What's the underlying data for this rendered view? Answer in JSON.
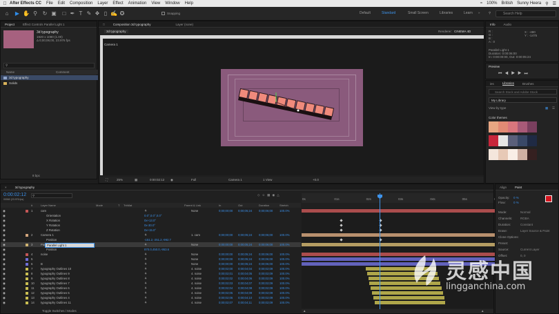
{
  "menubar": {
    "app_name": "After Effects CC",
    "items": [
      "File",
      "Edit",
      "Composition",
      "Layer",
      "Effect",
      "Animation",
      "View",
      "Window",
      "Help"
    ],
    "right_items": [
      "100%",
      "British",
      "Sunny Heera"
    ]
  },
  "toolbar": {
    "snapping_label": "Snapping",
    "workspaces": [
      "Default",
      "Standard",
      "Small Screen",
      "Libraries",
      "Learn"
    ],
    "active_workspace": "Standard",
    "search_placeholder": "Search Help"
  },
  "project_panel": {
    "tabs": [
      "Project",
      "Effect Controls Parallel Light 1"
    ],
    "item_name": "3d typography",
    "item_info": [
      "1920 x 1080 (1.00)",
      "Δ 0;00;06;00, 23.976 fps"
    ],
    "col_name": "Name",
    "col_comment": "Comment",
    "items": [
      "3d typography",
      "Solids"
    ],
    "footer_label": "8 bpc"
  },
  "comp_panel": {
    "tabs": [
      "Composition 3d typography",
      "Layer (none)"
    ],
    "sub_tab": "3d typography",
    "renderer_label": "Renderer:",
    "renderer_value": "CINEMA 4D",
    "view_label": "Camera 1",
    "footer": {
      "zoom": "25%",
      "time": "0:00:02:12",
      "res": "Full",
      "camera": "Camera 1",
      "views": "1 View",
      "exposure": "+0.0"
    }
  },
  "info_panel": {
    "tabs": [
      "Info",
      "Audio"
    ],
    "rgb": [
      "R :",
      "G :",
      "B :",
      "A : 0"
    ],
    "coords": [
      "X : -480",
      "Y : -1475"
    ],
    "layer_name": "Parallel Light 1",
    "duration": "Duration: 0:00:06:00",
    "in_out": "In: 0:00:00:00, Out: 0:00:05:24"
  },
  "preview_panel": {
    "title": "Preview"
  },
  "libraries_panel": {
    "tabs": [
      "ies",
      "Libraries",
      "Brushes"
    ],
    "search_placeholder": "Search Stock and Adobe Stock",
    "library_name": "My Library",
    "view_by": "View by type",
    "section": "Color themes",
    "themes": [
      [
        "#e8a682",
        "#e28a74",
        "#d9767d",
        "#a85a78",
        "#7a3f5e"
      ],
      [
        "#c7263b",
        "#e6e6e6",
        "#5a5f7a",
        "#394867",
        "#1f2a44"
      ],
      [
        "#f4e6dc",
        "#e7c9b6",
        "#f9eee6",
        "#cfb0a3",
        "#352020"
      ]
    ]
  },
  "align_panel": {
    "tabs": [
      "Align",
      "Paint"
    ],
    "opacity_label": "Opacity:",
    "opacity_value": "0 %",
    "flow_label": "Flow:",
    "flow_value": "0 %",
    "rows": [
      "Mode:",
      "Channels:",
      "Duration:",
      "Erase:",
      "Clone Options:",
      "Preset:",
      "Source:",
      "Offset:"
    ],
    "values": [
      "Normal",
      "RGBA",
      "Constant",
      "Layer Source & Paint",
      "",
      "",
      "Current Layer",
      "0, 0"
    ]
  },
  "timeline": {
    "tab": "3d typography",
    "timecode": "0:00:02:12",
    "timecode_sub": "00060 (23.976 fps)",
    "headers": [
      "#",
      "Layer Name",
      "Mode",
      "T",
      "TrkMat",
      "Parent & Link",
      "In",
      "Out",
      "Duration",
      "Stretch"
    ],
    "ruler": [
      "0s",
      "01s",
      "02s",
      "03s",
      "04s",
      "05s",
      "06s"
    ],
    "layers": [
      {
        "num": "1",
        "name": "cam",
        "color": "#c45656",
        "mode": "",
        "parent": "None",
        "in": "0;00;00;00",
        "out": "0;00;05;24",
        "dur": "0;00;06;00",
        "stretch": "100.0%"
      },
      {
        "num": "",
        "name": "Orientation",
        "color": "",
        "mode": "0.0°,0.0°,0.0°",
        "parent": "",
        "in": "",
        "out": "",
        "dur": "",
        "stretch": ""
      },
      {
        "num": "",
        "name": "X Rotation",
        "color": "",
        "mode": "0x+13.0°",
        "parent": "",
        "in": "",
        "out": "",
        "dur": "",
        "stretch": ""
      },
      {
        "num": "",
        "name": "Y Rotation",
        "color": "",
        "mode": "0x-30.0°",
        "parent": "",
        "in": "",
        "out": "",
        "dur": "",
        "stretch": ""
      },
      {
        "num": "",
        "name": "Z Rotation",
        "color": "",
        "mode": "0x+15.0°",
        "parent": "",
        "in": "",
        "out": "",
        "dur": "",
        "stretch": ""
      },
      {
        "num": "2",
        "name": "Camera 1",
        "color": "#d3a57c",
        "mode": "",
        "parent": "1. cam",
        "in": "0;00;00;00",
        "out": "0;00;05;24",
        "dur": "0;00;06;00",
        "stretch": "100.0%"
      },
      {
        "num": "",
        "name": "Position",
        "color": "",
        "mode": "-151.2,-251.2,-992.7",
        "parent": "",
        "in": "",
        "out": "",
        "dur": "",
        "stretch": ""
      },
      {
        "num": "3",
        "name": "Parallel Light 1",
        "color": "#d0b470",
        "mode": "",
        "parent": "None",
        "in": "0;00;00;00",
        "out": "0;00;05;24",
        "dur": "0;00;06;00",
        "stretch": "100.0%"
      },
      {
        "num": "",
        "name": "Position",
        "color": "",
        "mode": "870.0,450.0,-953.6",
        "parent": "",
        "in": "",
        "out": "",
        "dur": "",
        "stretch": ""
      },
      {
        "num": "4",
        "name": "noise",
        "color": "#c45656",
        "mode": "",
        "parent": "None",
        "in": "0;00;00;00",
        "out": "0;00;05;24",
        "dur": "0;00;06;00",
        "stretch": "100.0%"
      },
      {
        "num": "5",
        "name": "",
        "color": "#6f6fd8",
        "mode": "",
        "parent": "None",
        "in": "0;00;00;00",
        "out": "0;00;05;24",
        "dur": "0;00;06;00",
        "stretch": "100.0%"
      },
      {
        "num": "6",
        "name": "B",
        "color": "#6f6fd8",
        "mode": "",
        "parent": "None",
        "in": "0;00;00;00",
        "out": "0;00;05;24",
        "dur": "0;00;06;00",
        "stretch": "100.0%"
      },
      {
        "num": "7",
        "name": "typography Outlines 10",
        "color": "#c9be52",
        "mode": "",
        "parent": "4. noise",
        "in": "0;00;02;00",
        "out": "0;00;04;04",
        "dur": "0;00;02;09",
        "stretch": "100.0%"
      },
      {
        "num": "8",
        "name": "typography Outlines 9",
        "color": "#c9be52",
        "mode": "",
        "parent": "4. noise",
        "in": "0;00;02;01",
        "out": "0;00;04;05",
        "dur": "0;00;02;09",
        "stretch": "100.0%"
      },
      {
        "num": "9",
        "name": "typography Outlines 8",
        "color": "#c9be52",
        "mode": "",
        "parent": "4. noise",
        "in": "0;00;02;02",
        "out": "0;00;04;06",
        "dur": "0;00;02;09",
        "stretch": "100.0%"
      },
      {
        "num": "10",
        "name": "typography Outlines 7",
        "color": "#c9be52",
        "mode": "",
        "parent": "4. noise",
        "in": "0;00;02;03",
        "out": "0;00;04;07",
        "dur": "0;00;02;09",
        "stretch": "100.0%"
      },
      {
        "num": "11",
        "name": "typography Outlines 6",
        "color": "#c9be52",
        "mode": "",
        "parent": "4. noise",
        "in": "0;00;02;04",
        "out": "0;00;04;08",
        "dur": "0;00;02;09",
        "stretch": "100.0%"
      },
      {
        "num": "12",
        "name": "typography Outlines 5",
        "color": "#c9be52",
        "mode": "",
        "parent": "4. noise",
        "in": "0;00;02;05",
        "out": "0;00;04;09",
        "dur": "0;00;02;09",
        "stretch": "100.0%"
      },
      {
        "num": "13",
        "name": "typography Outlines 4",
        "color": "#c9be52",
        "mode": "",
        "parent": "4. noise",
        "in": "0;00;02;06",
        "out": "0;00;04;10",
        "dur": "0;00;02;09",
        "stretch": "100.0%"
      },
      {
        "num": "14",
        "name": "typography Outlines 11",
        "color": "#c9be52",
        "mode": "",
        "parent": "4. noise",
        "in": "0;00;02;07",
        "out": "0;00;04;11",
        "dur": "0;00;02;09",
        "stretch": "100.0%"
      }
    ],
    "rename_field": "Parallel Light 1",
    "footer_label": "Toggle Switches / Modes"
  },
  "watermark": {
    "cn": "灵感中国",
    "url": "lingganchina.com"
  },
  "colors": {
    "accent": "#2f8ce8",
    "comp_bg": "#8a5a7c",
    "playhead": "#3e93ea"
  }
}
